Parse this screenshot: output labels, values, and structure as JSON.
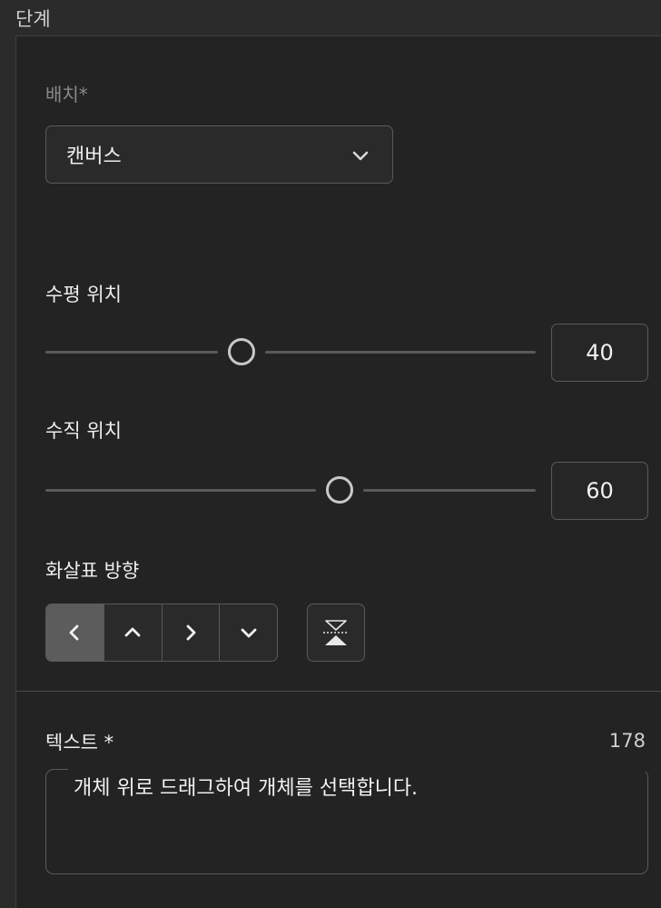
{
  "section": {
    "title": "단계"
  },
  "placement": {
    "label": "배치*",
    "selected": "캔버스"
  },
  "horizontal": {
    "label": "수평 위치",
    "value": "40",
    "level": 40
  },
  "vertical": {
    "label": "수직 위치",
    "value": "60",
    "level": 60
  },
  "arrow": {
    "label": "화살표 방향",
    "directions": [
      "left-arrow-icon",
      "up-arrow-icon",
      "right-arrow-icon",
      "down-arrow-icon"
    ],
    "selected": "left"
  },
  "text": {
    "label": "텍스트 *",
    "count": "178",
    "value": "개체 위로 드래그하여 개체를 선택합니다."
  },
  "colors": {
    "background": "#232323",
    "border": "#5a5a5a",
    "active_segment": "#5c5c5c"
  }
}
